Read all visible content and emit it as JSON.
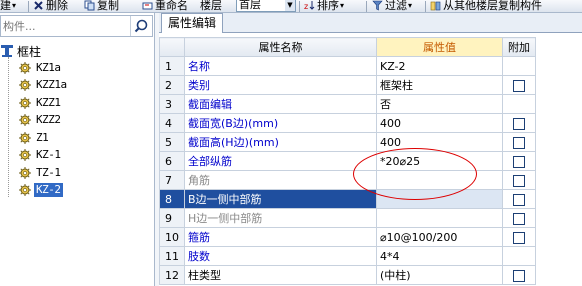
{
  "toolbar": {
    "items": [
      {
        "label": "建",
        "icon": "new-icon"
      },
      {
        "label": "删除",
        "icon": "delete-icon"
      },
      {
        "label": "复制",
        "icon": "copy-icon"
      },
      {
        "label": "重命名",
        "icon": "rename-icon"
      },
      {
        "label": "楼层"
      },
      {
        "label": "排序",
        "icon": "sort-icon"
      },
      {
        "label": "过滤",
        "icon": "filter-icon"
      },
      {
        "label": "从其他楼层复制构件",
        "icon": "copy-floor-icon"
      }
    ],
    "floor_value": "首层"
  },
  "search": {
    "placeholder": "构件..."
  },
  "tree": {
    "root": "框柱",
    "items": [
      "KZ1a",
      "KZZ1a",
      "KZZ1",
      "KZZ2",
      "Z1",
      "KZ-1",
      "TZ-1",
      "KZ-2"
    ],
    "selected": "KZ-2"
  },
  "panel": {
    "tab": "属性编辑"
  },
  "grid": {
    "headers": {
      "name": "属性名称",
      "value": "属性值",
      "attach": "附加"
    },
    "rows": [
      {
        "num": "1",
        "name": "名称",
        "value": "KZ-2",
        "checkbox": false
      },
      {
        "num": "2",
        "name": "类别",
        "value": "框架柱",
        "checkbox": true
      },
      {
        "num": "3",
        "name": "截面编辑",
        "value": "否",
        "checkbox": false
      },
      {
        "num": "4",
        "name": "截面宽(B边)(mm)",
        "value": "400",
        "checkbox": true
      },
      {
        "num": "5",
        "name": "截面高(H边)(mm)",
        "value": "400",
        "checkbox": true
      },
      {
        "num": "6",
        "name": "全部纵筋",
        "value": "*20⌀25",
        "checkbox": true
      },
      {
        "num": "7",
        "name": "角筋",
        "value": "",
        "checkbox": true,
        "grey": true
      },
      {
        "num": "8",
        "name": "B边一侧中部筋",
        "value": "",
        "checkbox": true,
        "selected": true
      },
      {
        "num": "9",
        "name": "H边一侧中部筋",
        "value": "",
        "checkbox": true,
        "grey": true
      },
      {
        "num": "10",
        "name": "箍筋",
        "value": "⌀10@100/200",
        "checkbox": true
      },
      {
        "num": "11",
        "name": "肢数",
        "value": "4*4",
        "checkbox": false
      },
      {
        "num": "12",
        "name": "柱类型",
        "value": "(中柱)",
        "checkbox": true,
        "plain": true
      }
    ]
  }
}
